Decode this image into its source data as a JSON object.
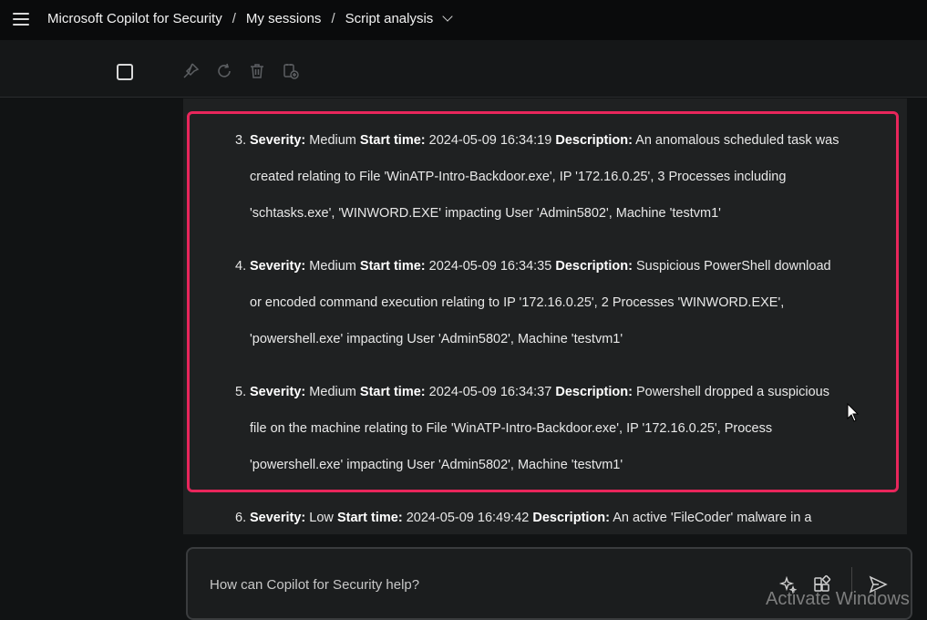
{
  "header": {
    "breadcrumbs": [
      "Microsoft Copilot for Security",
      "My sessions",
      "Script analysis"
    ],
    "separator": "/"
  },
  "toolbar": {
    "icons": [
      "checkbox",
      "pin-icon",
      "refresh-icon",
      "trash-icon",
      "add-to-pinboard-icon"
    ]
  },
  "incidents": [
    {
      "number": "3.",
      "severity_label": "Severity:",
      "severity": "Medium",
      "start_label": "Start time:",
      "start": "2024-05-09 16:34:19",
      "desc_label": "Description:",
      "lines": [
        "An anomalous scheduled task was",
        "created relating to File 'WinATP-Intro-Backdoor.exe', IP '172.16.0.25', 3 Processes including",
        "'schtasks.exe', 'WINWORD.EXE' impacting User 'Admin5802', Machine 'testvm1'"
      ]
    },
    {
      "number": "4.",
      "severity_label": "Severity:",
      "severity": "Medium",
      "start_label": "Start time:",
      "start": "2024-05-09 16:34:35",
      "desc_label": "Description:",
      "lines": [
        "Suspicious PowerShell download",
        "or encoded command execution relating to IP '172.16.0.25', 2 Processes 'WINWORD.EXE',",
        "'powershell.exe' impacting User 'Admin5802', Machine 'testvm1'"
      ]
    },
    {
      "number": "5.",
      "severity_label": "Severity:",
      "severity": "Medium",
      "start_label": "Start time:",
      "start": "2024-05-09 16:34:37",
      "desc_label": "Description:",
      "lines": [
        "Powershell dropped a suspicious",
        "file on the machine relating to File 'WinATP-Intro-Backdoor.exe', IP '172.16.0.25', Process",
        "'powershell.exe' impacting User 'Admin5802', Machine 'testvm1'"
      ]
    },
    {
      "number": "6.",
      "severity_label": "Severity:",
      "severity": "Low",
      "start_label": "Start time:",
      "start": "2024-05-09 16:49:42",
      "desc_label": "Description:",
      "lines": [
        "An active 'FileCoder' malware in a"
      ]
    }
  ],
  "prompt": {
    "placeholder": "How can Copilot for Security help?"
  },
  "watermark": "Activate Windows",
  "colors": {
    "highlight_border": "#e8265b",
    "background": "#111314",
    "card": "#1f2122"
  }
}
